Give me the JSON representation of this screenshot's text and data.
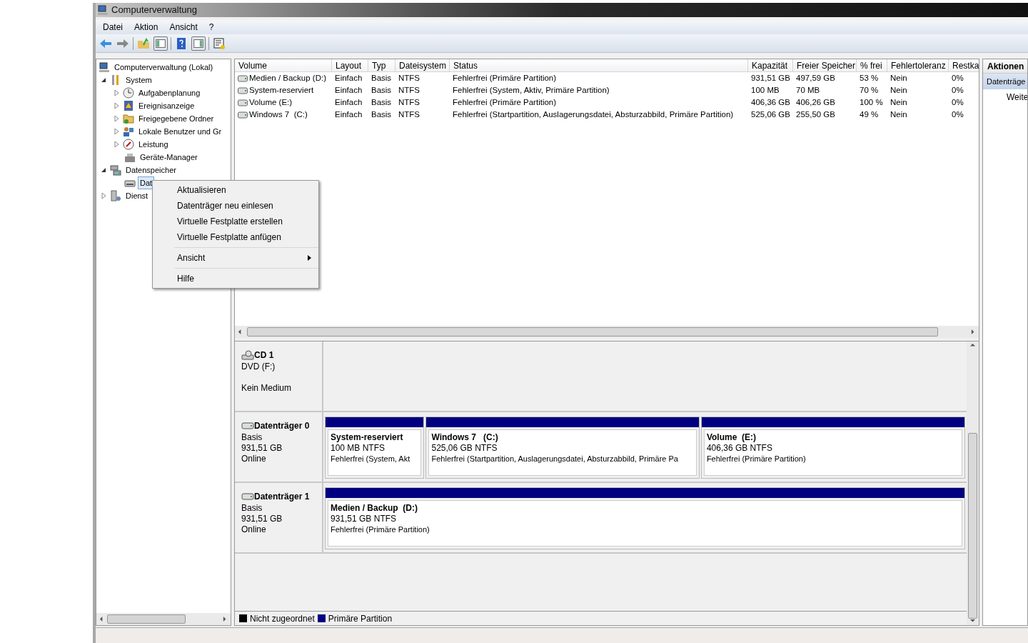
{
  "window": {
    "title": "Computerverwaltung"
  },
  "menu": [
    "Datei",
    "Aktion",
    "Ansicht",
    "?"
  ],
  "tree": [
    {
      "label": "Computerverwaltung (Lokal)",
      "kind": "computer",
      "selected": false,
      "children": [
        {
          "label": "System",
          "kind": "tools",
          "expanded": true,
          "selected": false,
          "children": [
            {
              "label": "Aufgabenplanung",
              "kind": "clock",
              "expanded": false,
              "selected": false
            },
            {
              "label": "Ereignisanzeige",
              "kind": "log",
              "expanded": false,
              "selected": false
            },
            {
              "label": "Freigegebene Ordner",
              "kind": "folder",
              "expanded": false,
              "selected": false
            },
            {
              "label": "Lokale Benutzer und Gr",
              "kind": "users",
              "expanded": false,
              "selected": false
            },
            {
              "label": "Leistung",
              "kind": "gauge",
              "expanded": false,
              "selected": false
            },
            {
              "label": "Geräte-Manager",
              "kind": "device",
              "selected": false
            }
          ]
        },
        {
          "label": "Datenspeicher",
          "kind": "storage",
          "expanded": true,
          "selected": false,
          "children": [
            {
              "label": "Dat",
              "kind": "disk",
              "selected": true
            }
          ]
        },
        {
          "label": "Dienst",
          "kind": "server",
          "expanded": false,
          "selected": false
        }
      ]
    }
  ],
  "table": {
    "columns": [
      "Volume",
      "Layout",
      "Typ",
      "Dateisystem",
      "Status",
      "Kapazität",
      "Freier Speicher",
      "% frei",
      "Fehlertoleranz",
      "Restka"
    ],
    "rows": [
      [
        "Medien / Backup (D:)",
        "Einfach",
        "Basis",
        "NTFS",
        "Fehlerfrei (Primäre Partition)",
        "931,51 GB",
        "497,59 GB",
        "53 %",
        "Nein",
        "0%"
      ],
      [
        "System-reserviert",
        "Einfach",
        "Basis",
        "NTFS",
        "Fehlerfrei (System, Aktiv, Primäre Partition)",
        "100 MB",
        "70 MB",
        "70 %",
        "Nein",
        "0%"
      ],
      [
        "Volume (E:)",
        "Einfach",
        "Basis",
        "NTFS",
        "Fehlerfrei (Primäre Partition)",
        "406,36 GB",
        "406,26 GB",
        "100 %",
        "Nein",
        "0%"
      ],
      [
        "Windows 7  (C:)",
        "Einfach",
        "Basis",
        "NTFS",
        "Fehlerfrei (Startpartition, Auslagerungsdatei, Absturzabbild, Primäre Partition)",
        "525,06 GB",
        "255,50 GB",
        "49 %",
        "Nein",
        "0%"
      ]
    ]
  },
  "disks": [
    {
      "kind": "cdrom",
      "name": "CD 1",
      "lines": [
        "DVD (F:)"
      ],
      "note": "Kein Medium"
    },
    {
      "kind": "disk",
      "name": "Datenträger 0",
      "lines": [
        "Basis",
        "931,51 GB",
        "Online"
      ],
      "partitions": [
        {
          "name": "System-reserviert",
          "size": "100 MB NTFS",
          "status": "Fehlerfrei (System, Akt",
          "color": "#000080"
        },
        {
          "name": "Windows 7   (C:)",
          "size": "525,06 GB NTFS",
          "status": "Fehlerfrei (Startpartition, Auslagerungsdatei, Absturzabbild, Primäre Pa",
          "color": "#000080"
        },
        {
          "name": "Volume  (E:)",
          "size": "406,36 GB NTFS",
          "status": "Fehlerfrei (Primäre Partition)",
          "color": "#000080"
        }
      ]
    },
    {
      "kind": "disk",
      "name": "Datenträger 1",
      "lines": [
        "Basis",
        "931,51 GB",
        "Online"
      ],
      "partitions": [
        {
          "name": "Medien / Backup  (D:)",
          "size": "931,51 GB NTFS",
          "status": "Fehlerfrei (Primäre Partition)",
          "color": "#000080"
        }
      ]
    }
  ],
  "legend": [
    {
      "label": "Nicht zugeordnet",
      "color": "#000000"
    },
    {
      "label": "Primäre Partition",
      "color": "#000080"
    }
  ],
  "actions": {
    "title": "Aktionen",
    "section": "Datenträge",
    "items": [
      "Weite"
    ]
  },
  "context_menu": {
    "groups": [
      [
        {
          "label": "Aktualisieren",
          "has_submenu": false
        },
        {
          "label": "Datenträger neu einlesen",
          "has_submenu": false
        },
        {
          "label": "Virtuelle Festplatte erstellen",
          "has_submenu": false
        },
        {
          "label": "Virtuelle Festplatte anfügen",
          "has_submenu": false
        }
      ],
      [
        {
          "label": "Ansicht",
          "has_submenu": true
        }
      ],
      [
        {
          "label": "Hilfe",
          "has_submenu": false
        }
      ]
    ]
  }
}
